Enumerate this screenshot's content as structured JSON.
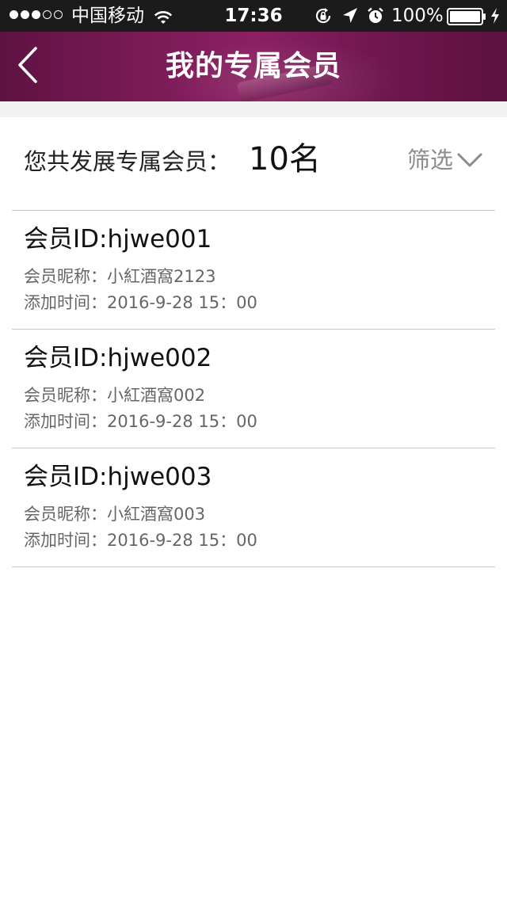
{
  "status_bar": {
    "carrier": "中国移动",
    "time": "17:36",
    "battery": "100%",
    "signal_filled": 3,
    "signal_total": 5
  },
  "header": {
    "title": "我的专属会员"
  },
  "summary": {
    "label": "您共发展专属会员：",
    "count": "10名",
    "filter_label": "筛选"
  },
  "members": [
    {
      "id": "会员ID:hjwe001",
      "nickname": "会员昵称：小紅酒窩2123",
      "added": "添加时间：2016-9-28 15：00"
    },
    {
      "id": "会员ID:hjwe002",
      "nickname": "会员昵称：小紅酒窩002",
      "added": "添加时间：2016-9-28 15：00"
    },
    {
      "id": "会员ID:hjwe003",
      "nickname": "会员昵称：小紅酒窩003",
      "added": "添加时间：2016-9-28 15：00"
    }
  ],
  "icons": {
    "back": "chevron-left-icon",
    "filter": "chevron-down-icon",
    "wifi": "wifi-icon",
    "rotation_lock": "rotation-lock-icon",
    "location": "location-arrow-icon",
    "alarm": "alarm-clock-icon",
    "battery": "battery-icon",
    "charging": "charging-bolt-icon"
  },
  "colors": {
    "nav_background": "#7a1a56",
    "status_bar": "#1b1b1b",
    "secondary_text": "#666666",
    "filter_text": "#8c8c8c"
  }
}
